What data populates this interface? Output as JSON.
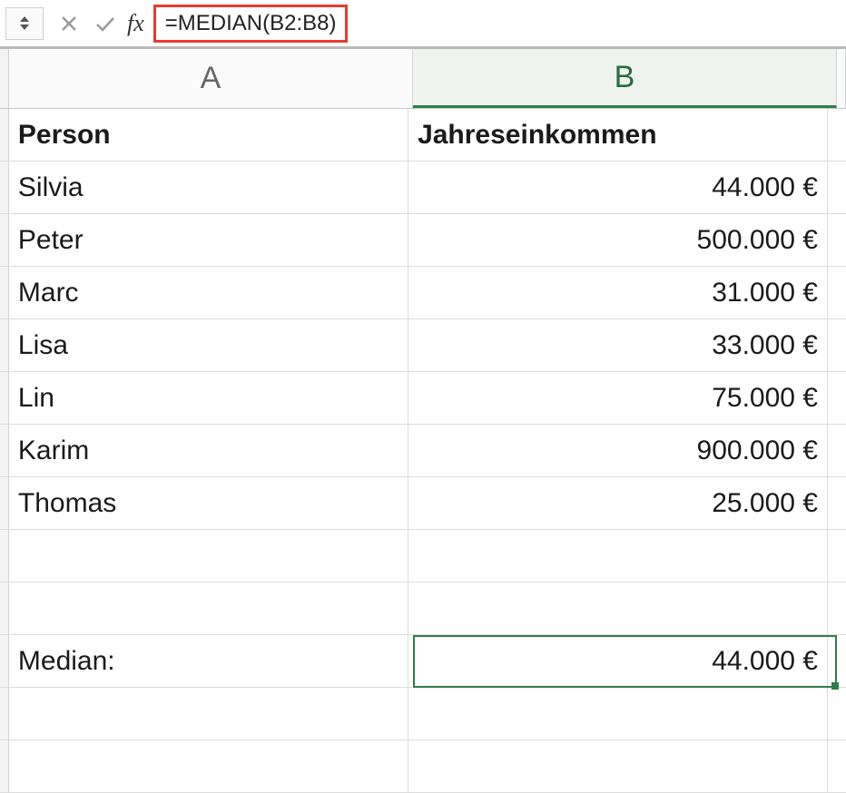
{
  "formula_bar": {
    "formula": "=MEDIAN(B2:B8)",
    "fx_label": "fx"
  },
  "columns": {
    "a": "A",
    "b": "B"
  },
  "headers": {
    "person": "Person",
    "income": "Jahreseinkommen"
  },
  "rows": [
    {
      "person": "Silvia",
      "income": "44.000 €"
    },
    {
      "person": "Peter",
      "income": "500.000 €"
    },
    {
      "person": "Marc",
      "income": "31.000 €"
    },
    {
      "person": "Lisa",
      "income": "33.000 €"
    },
    {
      "person": "Lin",
      "income": "75.000 €"
    },
    {
      "person": "Karim",
      "income": "900.000 €"
    },
    {
      "person": "Thomas",
      "income": "25.000 €"
    }
  ],
  "summary": {
    "label": "Median:",
    "value": "44.000 €"
  },
  "chart_data": {
    "type": "table",
    "title": "Jahreseinkommen",
    "columns": [
      "Person",
      "Jahreseinkommen (€)"
    ],
    "rows": [
      [
        "Silvia",
        44000
      ],
      [
        "Peter",
        500000
      ],
      [
        "Marc",
        31000
      ],
      [
        "Lisa",
        33000
      ],
      [
        "Lin",
        75000
      ],
      [
        "Karim",
        900000
      ],
      [
        "Thomas",
        25000
      ]
    ],
    "aggregate": {
      "label": "Median",
      "value": 44000
    }
  }
}
